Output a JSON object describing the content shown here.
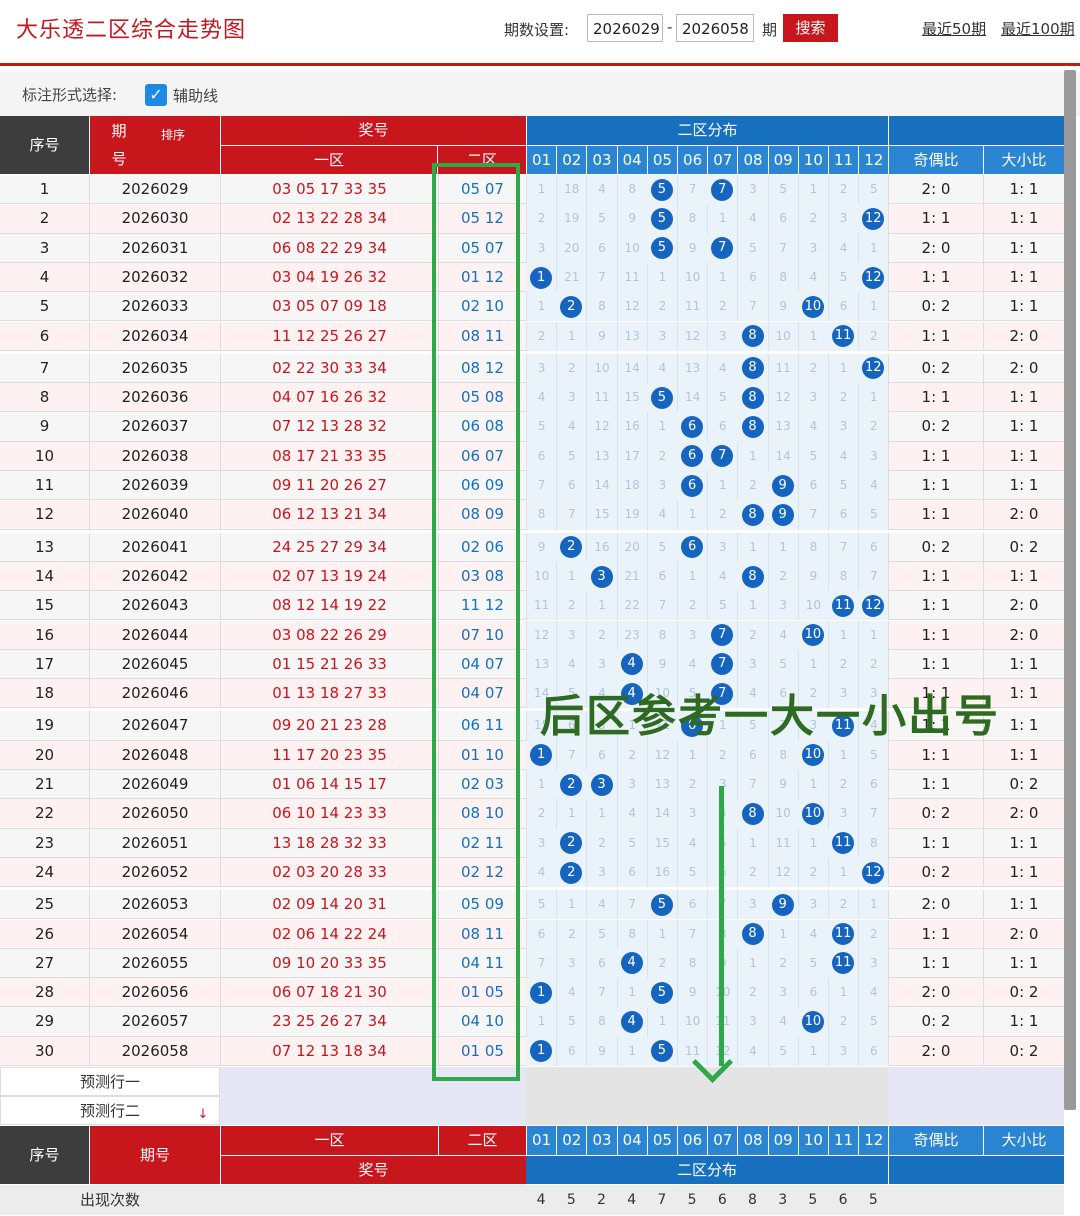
{
  "header": {
    "title": "大乐透二区综合走势图",
    "period_label": "期数设置:",
    "start_period": "2026029",
    "end_period": "2026058",
    "period_unit": "期",
    "search_label": "搜索",
    "quick_50": "最近50期",
    "quick_100": "最近100期"
  },
  "options": {
    "label": "标注形式选择:",
    "assist_line": "辅助线",
    "checked": true
  },
  "table": {
    "col_seq": "序号",
    "col_issue_a": "期",
    "col_issue_b": "号",
    "sort_label": "排序",
    "col_prize": "奖号",
    "col_zone1": "一区",
    "col_zone2": "二区",
    "col_dist": "二区分布",
    "col_odd_even": "奇偶比",
    "col_big_small": "大小比",
    "dist_numbers": [
      "01",
      "02",
      "03",
      "04",
      "05",
      "06",
      "07",
      "08",
      "09",
      "10",
      "11",
      "12"
    ],
    "rows": [
      {
        "seq": "1",
        "issue": "2026029",
        "front": "03 05 17 33 35",
        "back": "05 07",
        "miss": [
          "1",
          "18",
          "4",
          "8",
          "5",
          "7",
          "7",
          "3",
          "5",
          "1",
          "2",
          "5"
        ],
        "hits": [
          5,
          7
        ],
        "oe": "2: 0",
        "bs": "1: 1"
      },
      {
        "seq": "2",
        "issue": "2026030",
        "front": "02 13 22 28 34",
        "back": "05 12",
        "miss": [
          "2",
          "19",
          "5",
          "9",
          "5",
          "8",
          "1",
          "4",
          "6",
          "2",
          "3",
          "12"
        ],
        "hits": [
          5,
          12
        ],
        "oe": "1: 1",
        "bs": "1: 1"
      },
      {
        "seq": "3",
        "issue": "2026031",
        "front": "06 08 22 29 34",
        "back": "05 07",
        "miss": [
          "3",
          "20",
          "6",
          "10",
          "5",
          "9",
          "7",
          "5",
          "7",
          "3",
          "4",
          "1"
        ],
        "hits": [
          5,
          7
        ],
        "oe": "2: 0",
        "bs": "1: 1"
      },
      {
        "seq": "4",
        "issue": "2026032",
        "front": "03 04 19 26 32",
        "back": "01 12",
        "miss": [
          "1",
          "21",
          "7",
          "11",
          "1",
          "10",
          "1",
          "6",
          "8",
          "4",
          "5",
          "12"
        ],
        "hits": [
          1,
          12
        ],
        "oe": "1: 1",
        "bs": "1: 1"
      },
      {
        "seq": "5",
        "issue": "2026033",
        "front": "03 05 07 09 18",
        "back": "02 10",
        "miss": [
          "1",
          "2",
          "8",
          "12",
          "2",
          "11",
          "2",
          "7",
          "9",
          "10",
          "6",
          "1"
        ],
        "hits": [
          2,
          10
        ],
        "oe": "0: 2",
        "bs": "1: 1"
      },
      {
        "seq": "6",
        "issue": "2026034",
        "front": "11 12 25 26 27",
        "back": "08 11",
        "miss": [
          "2",
          "1",
          "9",
          "13",
          "3",
          "12",
          "3",
          "8",
          "10",
          "1",
          "11",
          "2"
        ],
        "hits": [
          8,
          11
        ],
        "oe": "1: 1",
        "bs": "2: 0"
      },
      {
        "seq": "7",
        "issue": "2026035",
        "front": "02 22 30 33 34",
        "back": "08 12",
        "miss": [
          "3",
          "2",
          "10",
          "14",
          "4",
          "13",
          "4",
          "8",
          "11",
          "2",
          "1",
          "12"
        ],
        "hits": [
          8,
          12
        ],
        "oe": "0: 2",
        "bs": "2: 0"
      },
      {
        "seq": "8",
        "issue": "2026036",
        "front": "04 07 16 26 32",
        "back": "05 08",
        "miss": [
          "4",
          "3",
          "11",
          "15",
          "5",
          "14",
          "5",
          "8",
          "12",
          "3",
          "2",
          "1"
        ],
        "hits": [
          5,
          8
        ],
        "oe": "1: 1",
        "bs": "1: 1"
      },
      {
        "seq": "9",
        "issue": "2026037",
        "front": "07 12 13 28 32",
        "back": "06 08",
        "miss": [
          "5",
          "4",
          "12",
          "16",
          "1",
          "6",
          "6",
          "8",
          "13",
          "4",
          "3",
          "2"
        ],
        "hits": [
          6,
          8
        ],
        "oe": "0: 2",
        "bs": "1: 1"
      },
      {
        "seq": "10",
        "issue": "2026038",
        "front": "08 17 21 33 35",
        "back": "06 07",
        "miss": [
          "6",
          "5",
          "13",
          "17",
          "2",
          "6",
          "7",
          "1",
          "14",
          "5",
          "4",
          "3"
        ],
        "hits": [
          6,
          7
        ],
        "oe": "1: 1",
        "bs": "1: 1"
      },
      {
        "seq": "11",
        "issue": "2026039",
        "front": "09 11 20 26 27",
        "back": "06 09",
        "miss": [
          "7",
          "6",
          "14",
          "18",
          "3",
          "6",
          "1",
          "2",
          "9",
          "6",
          "5",
          "4"
        ],
        "hits": [
          6,
          9
        ],
        "oe": "1: 1",
        "bs": "1: 1"
      },
      {
        "seq": "12",
        "issue": "2026040",
        "front": "06 12 13 21 34",
        "back": "08 09",
        "miss": [
          "8",
          "7",
          "15",
          "19",
          "4",
          "1",
          "2",
          "8",
          "9",
          "7",
          "6",
          "5"
        ],
        "hits": [
          8,
          9
        ],
        "oe": "1: 1",
        "bs": "2: 0"
      },
      {
        "seq": "13",
        "issue": "2026041",
        "front": "24 25 27 29 34",
        "back": "02 06",
        "miss": [
          "9",
          "2",
          "16",
          "20",
          "5",
          "6",
          "3",
          "1",
          "1",
          "8",
          "7",
          "6"
        ],
        "hits": [
          2,
          6
        ],
        "oe": "0: 2",
        "bs": "0: 2"
      },
      {
        "seq": "14",
        "issue": "2026042",
        "front": "02 07 13 19 24",
        "back": "03 08",
        "miss": [
          "10",
          "1",
          "3",
          "21",
          "6",
          "1",
          "4",
          "8",
          "2",
          "9",
          "8",
          "7"
        ],
        "hits": [
          3,
          8
        ],
        "oe": "1: 1",
        "bs": "1: 1"
      },
      {
        "seq": "15",
        "issue": "2026043",
        "front": "08 12 14 19 22",
        "back": "11 12",
        "miss": [
          "11",
          "2",
          "1",
          "22",
          "7",
          "2",
          "5",
          "1",
          "3",
          "10",
          "11",
          "12"
        ],
        "hits": [
          11,
          12
        ],
        "oe": "1: 1",
        "bs": "2: 0"
      },
      {
        "seq": "16",
        "issue": "2026044",
        "front": "03 08 22 26 29",
        "back": "07 10",
        "miss": [
          "12",
          "3",
          "2",
          "23",
          "8",
          "3",
          "7",
          "2",
          "4",
          "10",
          "1",
          "1"
        ],
        "hits": [
          7,
          10
        ],
        "oe": "1: 1",
        "bs": "2: 0"
      },
      {
        "seq": "17",
        "issue": "2026045",
        "front": "01 15 21 26 33",
        "back": "04 07",
        "miss": [
          "13",
          "4",
          "3",
          "4",
          "9",
          "4",
          "7",
          "3",
          "5",
          "1",
          "2",
          "2"
        ],
        "hits": [
          4,
          7
        ],
        "oe": "1: 1",
        "bs": "1: 1"
      },
      {
        "seq": "18",
        "issue": "2026046",
        "front": "01 13 18 27 33",
        "back": "04 07",
        "miss": [
          "14",
          "5",
          "4",
          "4",
          "10",
          "5",
          "7",
          "4",
          "6",
          "2",
          "3",
          "3"
        ],
        "hits": [
          4,
          7
        ],
        "oe": "1: 1",
        "bs": "1: 1"
      },
      {
        "seq": "19",
        "issue": "2026047",
        "front": "09 20 21 23 28",
        "back": "06 11",
        "miss": [
          "15",
          "6",
          "5",
          "1",
          "11",
          "6",
          "1",
          "5",
          "7",
          "3",
          "11",
          "4"
        ],
        "hits": [
          6,
          11
        ],
        "oe": "1: 1",
        "bs": "1: 1"
      },
      {
        "seq": "20",
        "issue": "2026048",
        "front": "11 17 20 23 35",
        "back": "01 10",
        "miss": [
          "1",
          "7",
          "6",
          "2",
          "12",
          "1",
          "2",
          "6",
          "8",
          "10",
          "1",
          "5"
        ],
        "hits": [
          1,
          10
        ],
        "oe": "1: 1",
        "bs": "1: 1"
      },
      {
        "seq": "21",
        "issue": "2026049",
        "front": "01 06 14 15 17",
        "back": "02 03",
        "miss": [
          "1",
          "2",
          "3",
          "3",
          "13",
          "2",
          "3",
          "7",
          "9",
          "1",
          "2",
          "6"
        ],
        "hits": [
          2,
          3
        ],
        "oe": "1: 1",
        "bs": "0: 2"
      },
      {
        "seq": "22",
        "issue": "2026050",
        "front": "06 10 14 23 33",
        "back": "08 10",
        "miss": [
          "2",
          "1",
          "1",
          "4",
          "14",
          "3",
          "4",
          "8",
          "10",
          "10",
          "3",
          "7"
        ],
        "hits": [
          8,
          10
        ],
        "oe": "0: 2",
        "bs": "2: 0"
      },
      {
        "seq": "23",
        "issue": "2026051",
        "front": "13 18 28 32 33",
        "back": "02 11",
        "miss": [
          "3",
          "2",
          "2",
          "5",
          "15",
          "4",
          "5",
          "1",
          "11",
          "1",
          "11",
          "8"
        ],
        "hits": [
          2,
          11
        ],
        "oe": "1: 1",
        "bs": "1: 1"
      },
      {
        "seq": "24",
        "issue": "2026052",
        "front": "02 03 20 28 33",
        "back": "02 12",
        "miss": [
          "4",
          "2",
          "3",
          "6",
          "16",
          "5",
          "6",
          "2",
          "12",
          "2",
          "1",
          "12"
        ],
        "hits": [
          2,
          12
        ],
        "oe": "0: 2",
        "bs": "1: 1"
      },
      {
        "seq": "25",
        "issue": "2026053",
        "front": "02 09 14 20 31",
        "back": "05 09",
        "miss": [
          "5",
          "1",
          "4",
          "7",
          "5",
          "6",
          "7",
          "3",
          "9",
          "3",
          "2",
          "1"
        ],
        "hits": [
          5,
          9
        ],
        "oe": "2: 0",
        "bs": "1: 1"
      },
      {
        "seq": "26",
        "issue": "2026054",
        "front": "02 06 14 22 24",
        "back": "08 11",
        "miss": [
          "6",
          "2",
          "5",
          "8",
          "1",
          "7",
          "8",
          "8",
          "1",
          "4",
          "11",
          "2"
        ],
        "hits": [
          8,
          11
        ],
        "oe": "1: 1",
        "bs": "2: 0"
      },
      {
        "seq": "27",
        "issue": "2026055",
        "front": "09 10 20 33 35",
        "back": "04 11",
        "miss": [
          "7",
          "3",
          "6",
          "4",
          "2",
          "8",
          "9",
          "1",
          "2",
          "5",
          "11",
          "3"
        ],
        "hits": [
          4,
          11
        ],
        "oe": "1: 1",
        "bs": "1: 1"
      },
      {
        "seq": "28",
        "issue": "2026056",
        "front": "06 07 18 21 30",
        "back": "01 05",
        "miss": [
          "1",
          "4",
          "7",
          "1",
          "5",
          "9",
          "10",
          "2",
          "3",
          "6",
          "1",
          "4"
        ],
        "hits": [
          1,
          5
        ],
        "oe": "2: 0",
        "bs": "0: 2"
      },
      {
        "seq": "29",
        "issue": "2026057",
        "front": "23 25 26 27 34",
        "back": "04 10",
        "miss": [
          "1",
          "5",
          "8",
          "4",
          "1",
          "10",
          "11",
          "3",
          "4",
          "10",
          "2",
          "5"
        ],
        "hits": [
          4,
          10
        ],
        "oe": "0: 2",
        "bs": "1: 1"
      },
      {
        "seq": "30",
        "issue": "2026058",
        "front": "07 12 13 18 34",
        "back": "01 05",
        "miss": [
          "1",
          "6",
          "9",
          "1",
          "5",
          "11",
          "12",
          "4",
          "5",
          "1",
          "3",
          "6"
        ],
        "hits": [
          1,
          5
        ],
        "oe": "2: 0",
        "bs": "0: 2"
      }
    ],
    "predict_1": "预测行一",
    "predict_2": "预测行二",
    "footer_count_label": "出现次数",
    "footer_counts": [
      "4",
      "5",
      "2",
      "4",
      "7",
      "5",
      "6",
      "8",
      "3",
      "5",
      "6",
      "5"
    ]
  },
  "annotation": {
    "text": "后区参考一大一小出号"
  },
  "colors": {
    "red": "#c8161d",
    "blue": "#1670bd",
    "ball": "#1565c0",
    "green": "#2fa84a"
  }
}
